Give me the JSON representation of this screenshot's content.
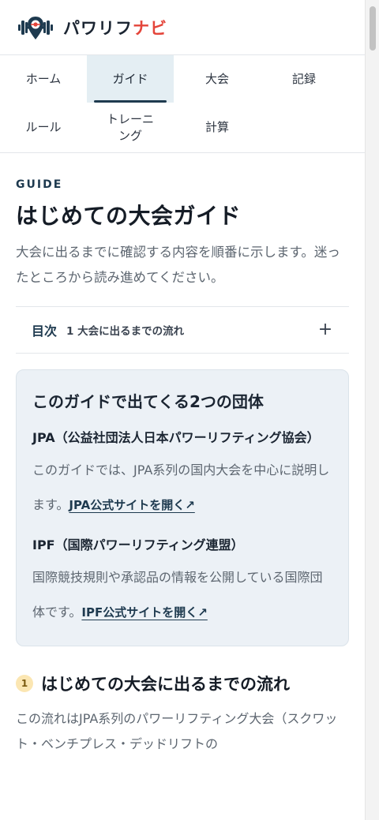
{
  "header": {
    "brand_main": "パワリフ",
    "brand_accent": "ナビ",
    "logo_icon": "barbell-map-pin-icon"
  },
  "nav": {
    "items": [
      {
        "label": "ホーム"
      },
      {
        "label": "ガイド"
      },
      {
        "label": "大会"
      },
      {
        "label": "記録"
      },
      {
        "label": "ルール"
      },
      {
        "label": "トレーニング"
      },
      {
        "label": "計算"
      }
    ],
    "active_index": 1
  },
  "guide": {
    "eyebrow": "GUIDE",
    "title": "はじめての大会ガイド",
    "lead": "大会に出るまでに確認する内容を順番に示します。迷ったところから読み進めてください。"
  },
  "toc": {
    "label": "目次",
    "current": "1 大会に出るまでの流れ",
    "toggle": "+"
  },
  "organizations": {
    "title": "このガイドで出てくる2つの団体",
    "items": [
      {
        "name": "JPA（公益社団法人日本パワーリフティング協会）",
        "desc": "このガイドでは、JPA系列の国内大会を中心に説明します。",
        "link": "JPA公式サイトを開く↗"
      },
      {
        "name": "IPF（国際パワーリフティング連盟）",
        "desc": "国際競技規則や承認品の情報を公開している国際団体です。",
        "link": "IPF公式サイトを開く↗"
      }
    ]
  },
  "section1": {
    "number": "1",
    "title": "はじめての大会に出るまでの流れ",
    "body": "この流れはJPA系列のパワーリフティング大会（スクワット・ベンチプレス・デッドリフトの"
  },
  "colors": {
    "accent": "#1e3a4f",
    "brand_red": "#e4453a",
    "active_tab_bg": "#e4eef3",
    "card_bg": "#ecf1f6"
  }
}
